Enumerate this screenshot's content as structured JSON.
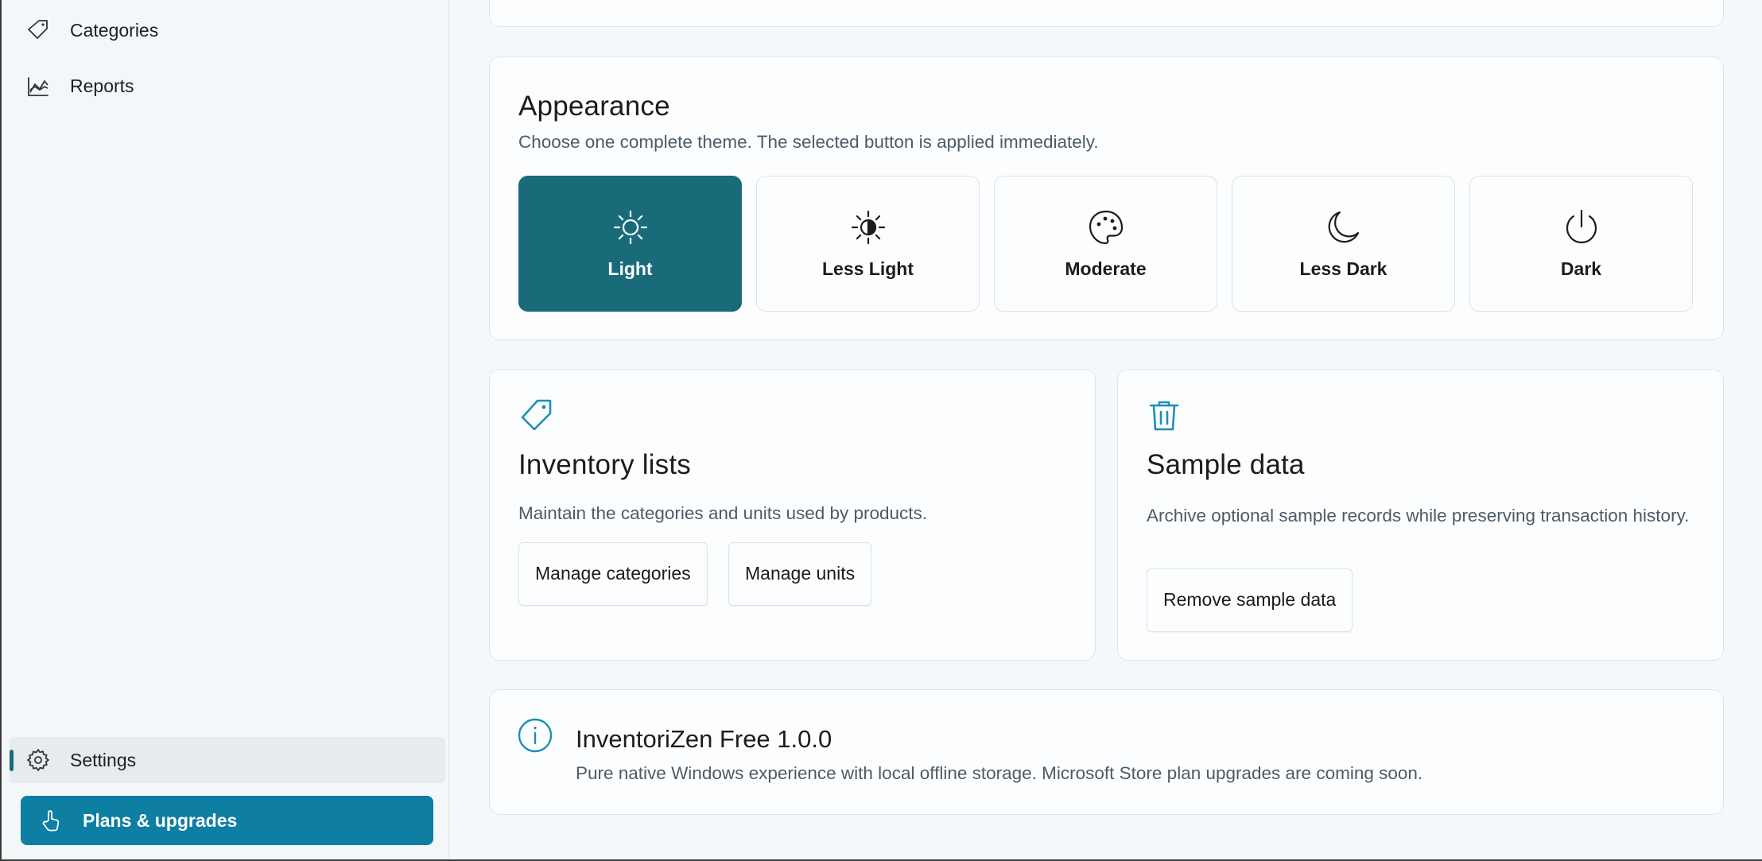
{
  "sidebar": {
    "items": [
      {
        "label": "Categories",
        "icon": "tag-icon"
      },
      {
        "label": "Reports",
        "icon": "area-chart-icon"
      }
    ],
    "settings": {
      "label": "Settings",
      "icon": "gear-icon",
      "selected": true
    },
    "plans_button": {
      "label": "Plans & upgrades",
      "icon": "hand-pointer-icon"
    }
  },
  "appearance": {
    "title": "Appearance",
    "description": "Choose one complete theme. The selected button is applied immediately.",
    "themes": [
      {
        "label": "Light",
        "icon": "sun-icon",
        "selected": true
      },
      {
        "label": "Less Light",
        "icon": "contrast-icon",
        "selected": false
      },
      {
        "label": "Moderate",
        "icon": "palette-icon",
        "selected": false
      },
      {
        "label": "Less Dark",
        "icon": "moon-icon",
        "selected": false
      },
      {
        "label": "Dark",
        "icon": "power-icon",
        "selected": false
      }
    ]
  },
  "inventory_lists": {
    "title": "Inventory lists",
    "description": "Maintain the categories and units used by products.",
    "buttons": {
      "manage_categories": "Manage categories",
      "manage_units": "Manage units"
    }
  },
  "sample_data": {
    "title": "Sample data",
    "description": "Archive optional sample records while preserving transaction history.",
    "button": "Remove sample data"
  },
  "about": {
    "title": "InventoriZen Free 1.0.0",
    "description": "Pure native Windows experience with local offline storage. Microsoft Store plan upgrades are coming soon."
  },
  "colors": {
    "accent": "#1a6b7a",
    "plans_button": "#0f7ea3",
    "icon_accent": "#1d8fb5"
  }
}
